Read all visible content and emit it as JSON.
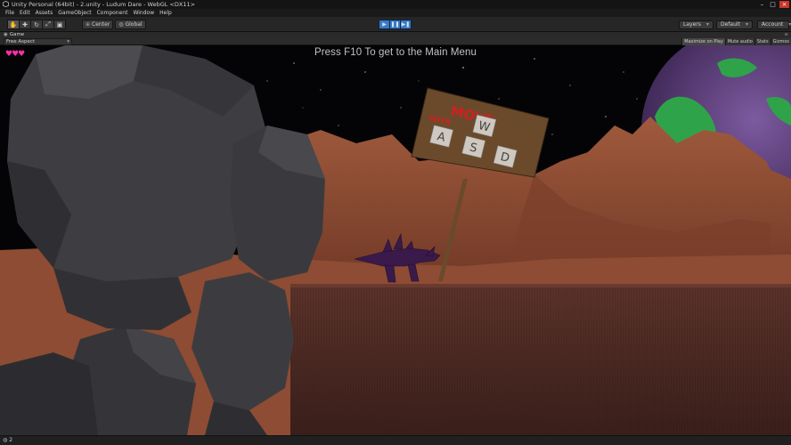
{
  "window": {
    "title": "Unity Personal (64bit) - 2.unity - Ludum Dare - WebGL <DX11>",
    "minimize_glyph": "–",
    "maximize_glyph": "□",
    "close_glyph": "×"
  },
  "menu": [
    "File",
    "Edit",
    "Assets",
    "GameObject",
    "Component",
    "Window",
    "Help"
  ],
  "toolbar": {
    "tools": [
      {
        "name": "hand-tool-icon",
        "glyph": "✋"
      },
      {
        "name": "move-tool-icon",
        "glyph": "✚"
      },
      {
        "name": "rotate-tool-icon",
        "glyph": "↻"
      },
      {
        "name": "scale-tool-icon",
        "glyph": "⤢"
      },
      {
        "name": "rect-tool-icon",
        "glyph": "▣"
      }
    ],
    "pivot_label": "Center",
    "space_label": "Global",
    "play_glyph": "▶",
    "pause_glyph": "❚❚",
    "step_glyph": "▶❚",
    "layers_label": "Layers",
    "layout_label": "Default",
    "account_label": "Account",
    "caret": "▾"
  },
  "game_view": {
    "tab_label": "Game",
    "aspect_label": "Free Aspect",
    "options": [
      "Maximize on Play",
      "Mute audio",
      "Stats",
      "Gizmos"
    ],
    "hint_text": "Press F10 To get to the Main Menu",
    "hearts": "♥♥♥",
    "sign_title": "MOVE",
    "sign_sub": "WITH",
    "keys": [
      "W",
      "A",
      "S",
      "D"
    ]
  },
  "status": {
    "text": "2"
  },
  "colors": {
    "hearts": "#ff2fa8",
    "planet_green": "#2fa34a",
    "planet_purple": "#5a3a70",
    "terrain": "#8a4a32",
    "platform": "#4a2b24",
    "rock": "#3c3c40",
    "creature": "#3a1a4a",
    "sign_red": "#d11f1f"
  }
}
